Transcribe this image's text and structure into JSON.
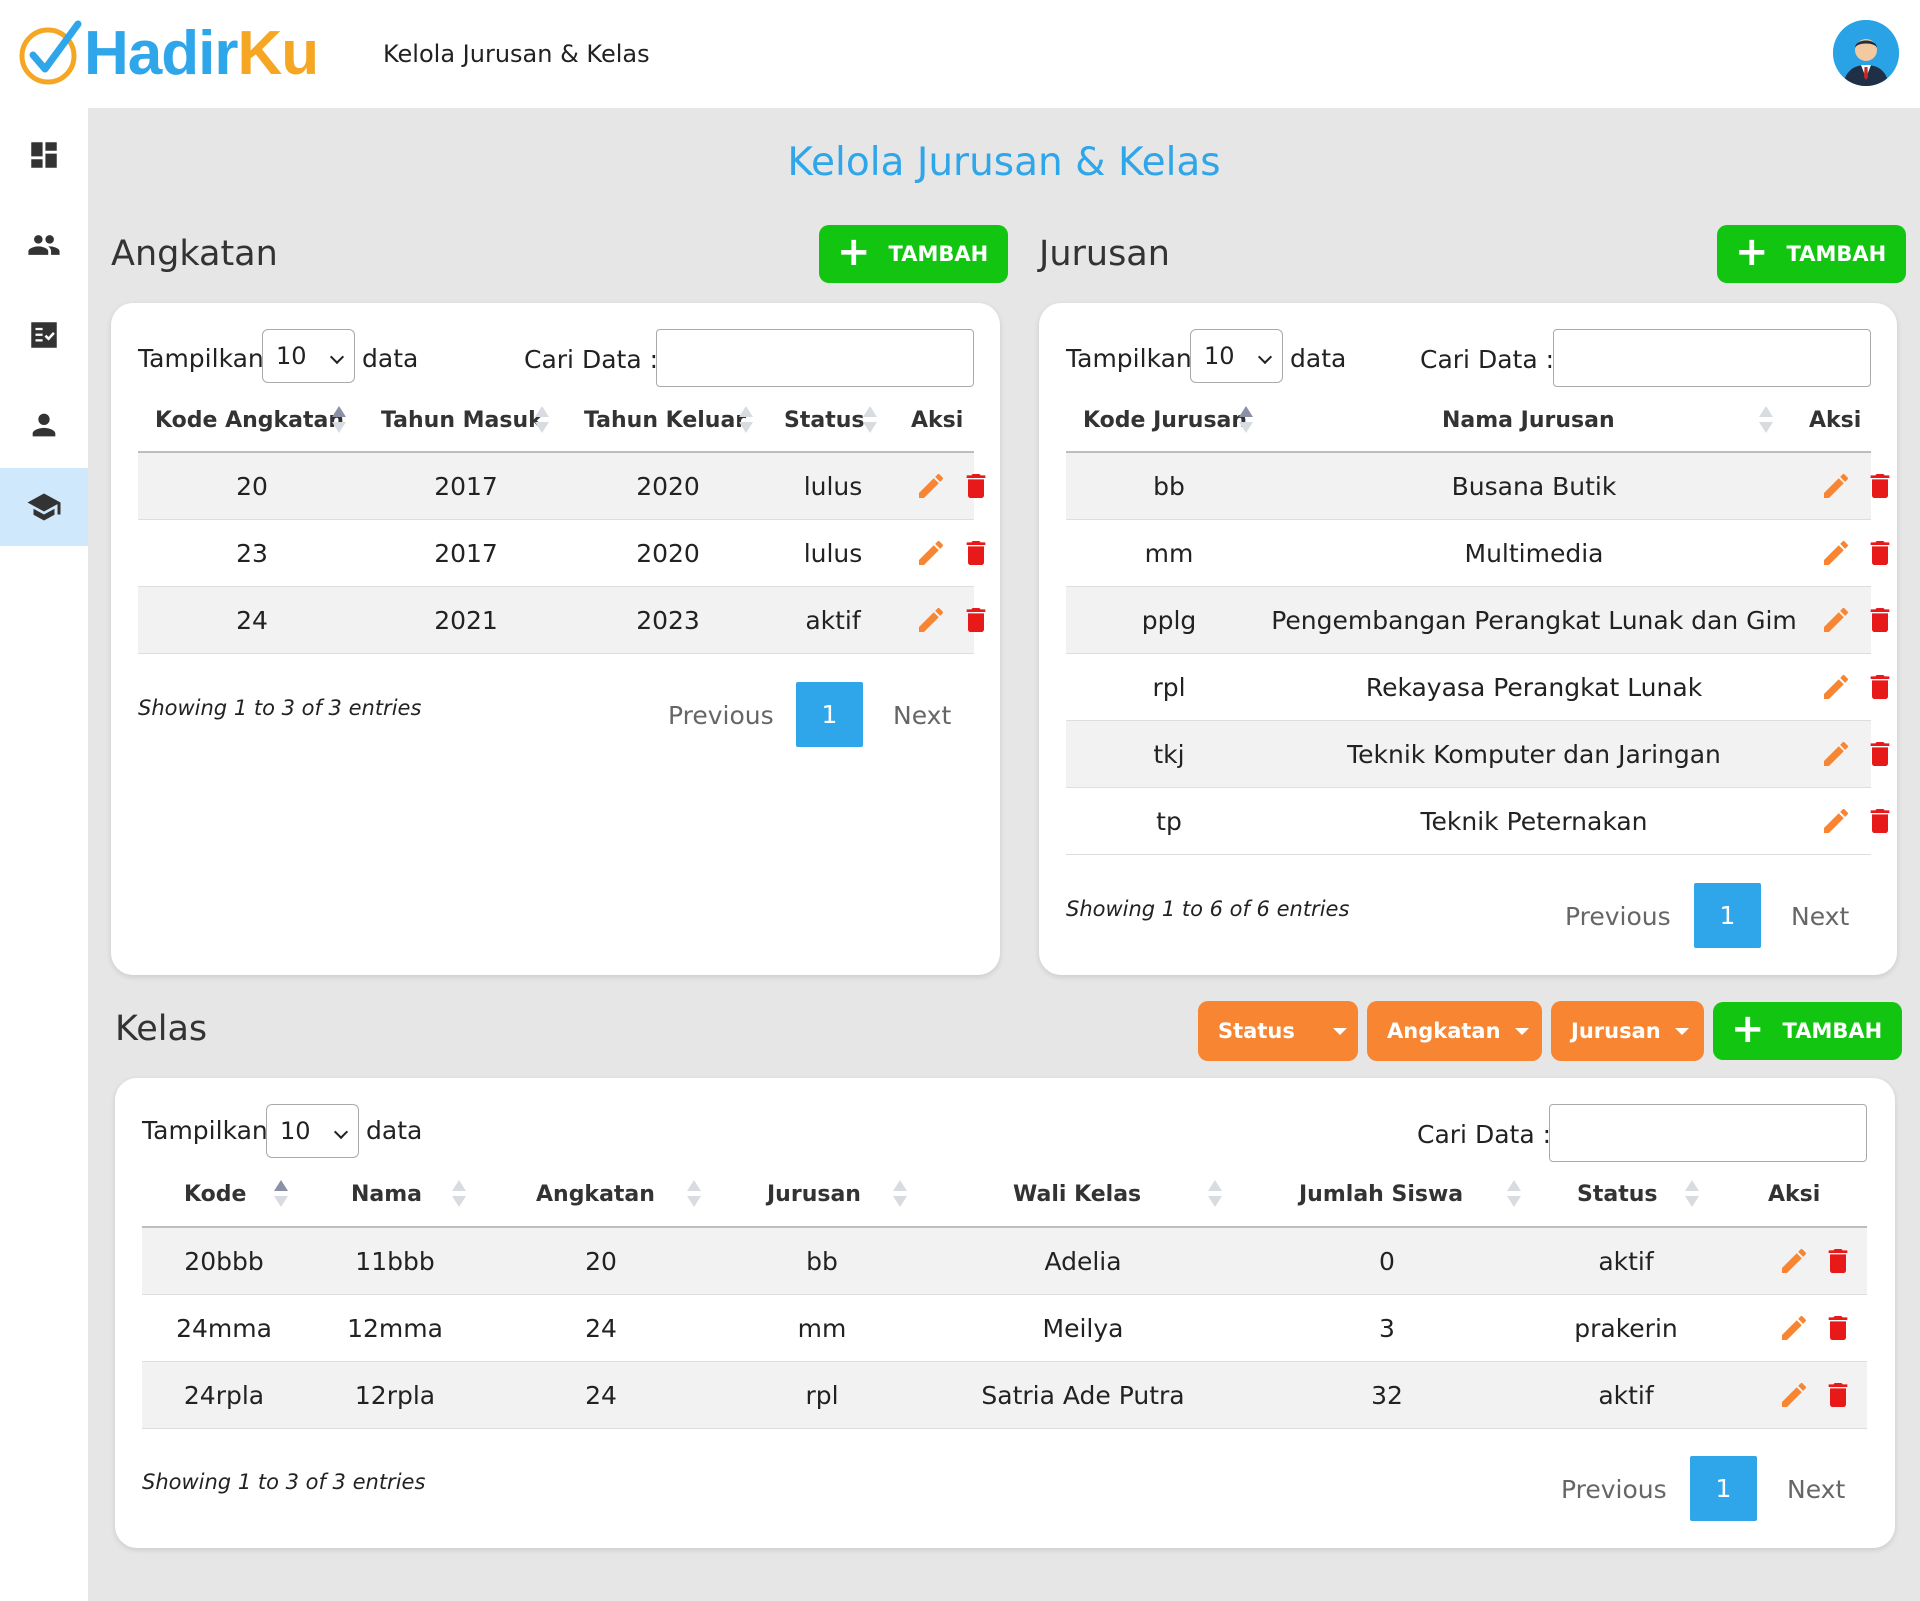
{
  "app": {
    "logo_part1": "Hadir",
    "logo_part2": "Ku",
    "top_title": "Kelola Jurusan & Kelas",
    "page_heading": "Kelola Jurusan & Kelas"
  },
  "sidebar": [
    {
      "icon": "dashboard-icon",
      "active": false
    },
    {
      "icon": "users-icon",
      "active": false
    },
    {
      "icon": "attendance-checklist-icon",
      "active": false
    },
    {
      "icon": "user-icon",
      "active": false
    },
    {
      "icon": "graduation-cap-icon",
      "active": true
    }
  ],
  "common": {
    "show_label": "Tampilkan",
    "data_label": "data",
    "search_label": "Cari Data :",
    "page_size": "10",
    "prev": "Previous",
    "next": "Next",
    "current_page": "1",
    "add_label": "TAMBAH"
  },
  "angkatan": {
    "title": "Angkatan",
    "columns": [
      "Kode Angkatan",
      "Tahun Masuk",
      "Tahun Keluar",
      "Status",
      "Aksi"
    ],
    "rows": [
      [
        "20",
        "2017",
        "2020",
        "lulus"
      ],
      [
        "23",
        "2017",
        "2020",
        "lulus"
      ],
      [
        "24",
        "2021",
        "2023",
        "aktif"
      ]
    ],
    "showing": "Showing 1 to 3 of 3 entries"
  },
  "jurusan": {
    "title": "Jurusan",
    "columns": [
      "Kode Jurusan",
      "Nama Jurusan",
      "Aksi"
    ],
    "rows": [
      [
        "bb",
        "Busana Butik"
      ],
      [
        "mm",
        "Multimedia"
      ],
      [
        "pplg",
        "Pengembangan Perangkat Lunak dan Gim"
      ],
      [
        "rpl",
        "Rekayasa Perangkat Lunak"
      ],
      [
        "tkj",
        "Teknik Komputer dan Jaringan"
      ],
      [
        "tp",
        "Teknik Peternakan"
      ]
    ],
    "showing": "Showing 1 to 6 of 6 entries"
  },
  "kelas": {
    "title": "Kelas",
    "filters": [
      "Status",
      "Angkatan",
      "Jurusan"
    ],
    "columns": [
      "Kode",
      "Nama",
      "Angkatan",
      "Jurusan",
      "Wali Kelas",
      "Jumlah Siswa",
      "Status",
      "Aksi"
    ],
    "rows": [
      [
        "20bbb",
        "11bbb",
        "20",
        "bb",
        "Adelia",
        "0",
        "aktif"
      ],
      [
        "24mma",
        "12mma",
        "24",
        "mm",
        "Meilya",
        "3",
        "prakerin"
      ],
      [
        "24rpla",
        "12rpla",
        "24",
        "rpl",
        "Satria Ade Putra",
        "32",
        "aktif"
      ]
    ],
    "showing": "Showing 1 to 3 of 3 entries"
  },
  "colors": {
    "accent": "#2fa6ea",
    "add_button": "#11c511",
    "filter_button": "#f88532",
    "edit_icon": "#f88532",
    "delete_icon": "#e81919"
  }
}
